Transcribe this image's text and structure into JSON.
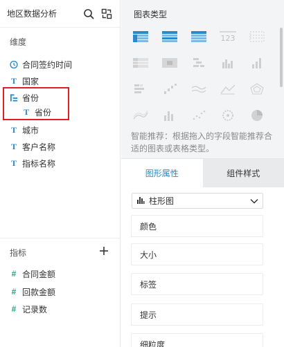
{
  "left": {
    "title": "地区数据分析",
    "dimension_label": "维度",
    "dimensions": [
      {
        "label": "合同签约时间",
        "icon": "clock-icon"
      },
      {
        "label": "国家",
        "icon": "text-type-icon"
      },
      {
        "label": "省份",
        "icon": "hierarchy-icon"
      },
      {
        "label": "省份",
        "icon": "text-type-icon"
      },
      {
        "label": "城市",
        "icon": "text-type-icon"
      },
      {
        "label": "客户名称",
        "icon": "text-type-icon"
      },
      {
        "label": "指标名称",
        "icon": "text-type-icon"
      }
    ],
    "metric_label": "指标",
    "metrics": [
      {
        "label": "合同金额",
        "icon": "number-type-icon"
      },
      {
        "label": "回款金额",
        "icon": "number-type-icon"
      },
      {
        "label": "记录数",
        "icon": "number-calc-icon"
      }
    ],
    "metric_icon_glyphs": [
      "#",
      "#",
      "#"
    ]
  },
  "right": {
    "title": "图表类型",
    "smart_tip": "智能推荐：根据拖入的字段智能推荐合适的图表或表格类型。",
    "tabs": [
      {
        "label": "图形属性",
        "active": true
      },
      {
        "label": "组件样式",
        "active": false
      }
    ],
    "chart_select": {
      "value": "柱形图",
      "icon": "bar-chart-icon"
    },
    "properties": [
      "颜色",
      "大小",
      "标签",
      "提示",
      "细粒度"
    ],
    "text_icon_glyph": "T",
    "colors": {
      "accent": "#2a8ac8",
      "highlight": "#e31b23",
      "number": "#22a67a"
    }
  }
}
